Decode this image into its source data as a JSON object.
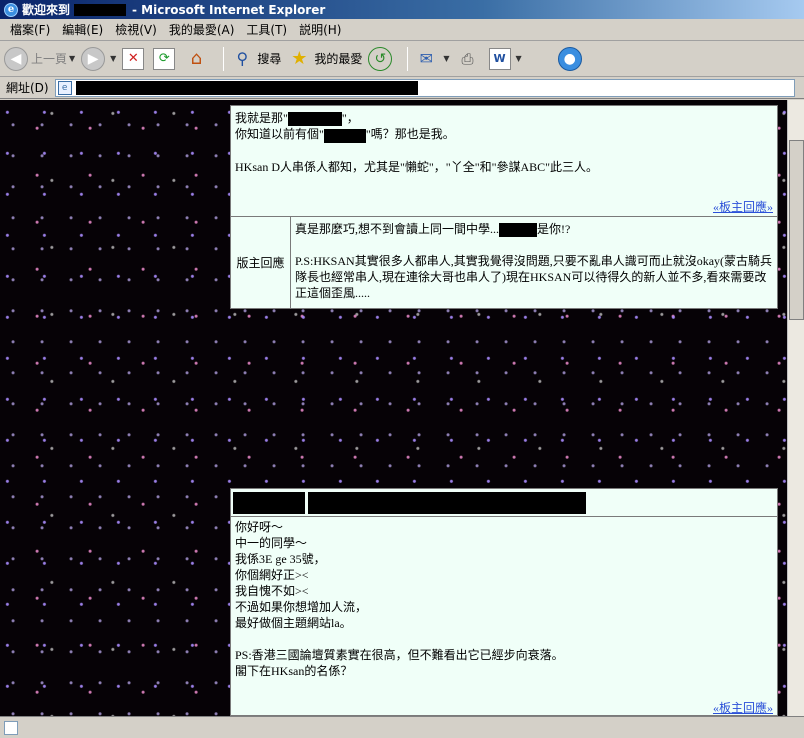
{
  "window": {
    "title_prefix": "歡迎來到",
    "title_suffix": "- Microsoft Internet Explorer"
  },
  "menu": [
    "檔案(F)",
    "編輯(E)",
    "檢視(V)",
    "我的最愛(A)",
    "工具(T)",
    "説明(H)"
  ],
  "toolbar": {
    "back": "上一頁",
    "search": "搜尋",
    "favorites": "我的最愛"
  },
  "address": {
    "label": "網址(D)"
  },
  "post1": {
    "line1_a": "我就是那\"",
    "line1_b": "\"，",
    "line2_a": "你知道以前有個\"",
    "line2_b": "\"嗎？那也是我。",
    "line3": "HKsan D人串係人都知，尤其是\"懶蛇\"，\"丫全\"和\"參謀ABC\"此三人。",
    "reply_link": "«板主回應»",
    "reply_label": "版主回應",
    "reply_line1_a": "真是那麼巧,想不到會讀上同一間中學...",
    "reply_line1_b": "是你!?",
    "reply_body": "P.S:HKSAN其實很多人都串人,其實我覺得沒問題,只要不亂串人識可而止就沒okay(蒙古騎兵隊長也經常串人,現在連徐大哥也串人了)現在HKSAN可以待得久的新人並不多,看來需要改正這個歪風....."
  },
  "post2": {
    "lines": [
      "你好呀～",
      "中一的同學～",
      "我係3E ge 35號，",
      "你個網好正><",
      "我自愧不如><",
      "不過如果你想增加人流，",
      "最好做個主題網站la。",
      "",
      "PS:香港三國論壇質素實在很高，但不難看出它已經步向衰落。",
      "閣下在HKsan的名係？"
    ],
    "reply_link": "«板主回應»"
  }
}
